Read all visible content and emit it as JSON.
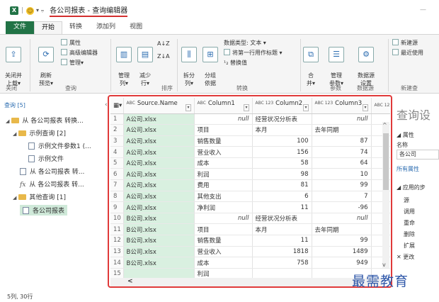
{
  "titlebar": {
    "app_icon": "X",
    "window_title": "各公司报表 - 查询编辑器"
  },
  "tabs": [
    "文件",
    "开始",
    "转换",
    "添加列",
    "视图"
  ],
  "ribbon": {
    "close_group": {
      "btn": "关闭并\n上载▾",
      "label": "关闭"
    },
    "query_group": {
      "refresh": "刷新\n预览▾",
      "properties": "属性",
      "advanced_editor": "高级编辑器",
      "manage": "管理▾",
      "label": "查询"
    },
    "columns_group": {
      "manage_cols": "管理\n列▾",
      "reduce_rows": "减少\n行▾",
      "label": "排序"
    },
    "transform_group": {
      "split": "拆分\n列▾",
      "group_by": "分组\n依据",
      "data_type": "数据类型: 文本 ▾",
      "first_row_header": "将第一行用作标题 ▾",
      "replace_values": "替换值",
      "label": "转换"
    },
    "combine_group": {
      "combine": "合\n并▾",
      "manage_params": "管理\n参数▾",
      "datasource": "数据源\n设置",
      "label_params": "参数",
      "label_ds": "数据源"
    },
    "new_query_group": {
      "new_source": "新建源",
      "recent_source": "最近使用",
      "label": "新建查"
    }
  },
  "left_pane": {
    "header": "查询 [5]",
    "items": [
      {
        "label": "从 各公司报表 转换...",
        "type": "folder"
      },
      {
        "label": "示例查询 [2]",
        "type": "folder"
      },
      {
        "label": "示例文件参数1 (...",
        "type": "param"
      },
      {
        "label": "示例文件",
        "type": "query"
      },
      {
        "label": "从 各公司报表 转...",
        "type": "query"
      },
      {
        "label": "从 各公司报表 转...",
        "type": "fx"
      },
      {
        "label": "其他查询 [1]",
        "type": "folder"
      },
      {
        "label": "各公司报表",
        "type": "table"
      }
    ]
  },
  "grid": {
    "columns": [
      {
        "type": "ABC",
        "name": "Source.Name"
      },
      {
        "type": "ABC",
        "name": "Column1"
      },
      {
        "type": "ABC 123",
        "name": "Column2"
      },
      {
        "type": "ABC 123",
        "name": "Column3"
      },
      {
        "type": "ABC 123",
        "name": ""
      }
    ],
    "rows": [
      {
        "n": "1",
        "src": "A公司.xlsx",
        "c1": "null",
        "c2": "经营状况分析表",
        "c3": "null"
      },
      {
        "n": "2",
        "src": "A公司.xlsx",
        "c1": "项目",
        "c2": "本月",
        "c3": "去年同期"
      },
      {
        "n": "3",
        "src": "A公司.xlsx",
        "c1": "销售数量",
        "c2": "100",
        "c3": "87"
      },
      {
        "n": "4",
        "src": "A公司.xlsx",
        "c1": "营业收入",
        "c2": "156",
        "c3": "74"
      },
      {
        "n": "5",
        "src": "A公司.xlsx",
        "c1": "成本",
        "c2": "58",
        "c3": "64"
      },
      {
        "n": "6",
        "src": "A公司.xlsx",
        "c1": "利润",
        "c2": "98",
        "c3": "10"
      },
      {
        "n": "7",
        "src": "A公司.xlsx",
        "c1": "费用",
        "c2": "81",
        "c3": "99"
      },
      {
        "n": "8",
        "src": "A公司.xlsx",
        "c1": "其他支出",
        "c2": "6",
        "c3": "7"
      },
      {
        "n": "9",
        "src": "A公司.xlsx",
        "c1": "净利润",
        "c2": "11",
        "c3": "-96"
      },
      {
        "n": "10",
        "src": "B公司.xlsx",
        "c1": "null",
        "c2": "经营状况分析表",
        "c3": "null"
      },
      {
        "n": "11",
        "src": "B公司.xlsx",
        "c1": "项目",
        "c2": "本月",
        "c3": "去年同期"
      },
      {
        "n": "12",
        "src": "B公司.xlsx",
        "c1": "销售数量",
        "c2": "11",
        "c3": "99"
      },
      {
        "n": "13",
        "src": "B公司.xlsx",
        "c1": "营业收入",
        "c2": "1818",
        "c3": "1489"
      },
      {
        "n": "14",
        "src": "B公司.xlsx",
        "c1": "成本",
        "c2": "758",
        "c3": "949"
      },
      {
        "n": "15",
        "src": "",
        "c1": "利润",
        "c2": "",
        "c3": ""
      }
    ]
  },
  "right_pane": {
    "title": "查询设",
    "properties": "属性",
    "name_label": "名称",
    "name_value": "各公司",
    "all_props": "所有属性",
    "applied_steps": "应用的步",
    "steps": [
      "源",
      "调用",
      "重命",
      "删除",
      "扩展",
      "更改"
    ]
  },
  "statusbar": "5列, 30行",
  "watermark": "最需教育"
}
